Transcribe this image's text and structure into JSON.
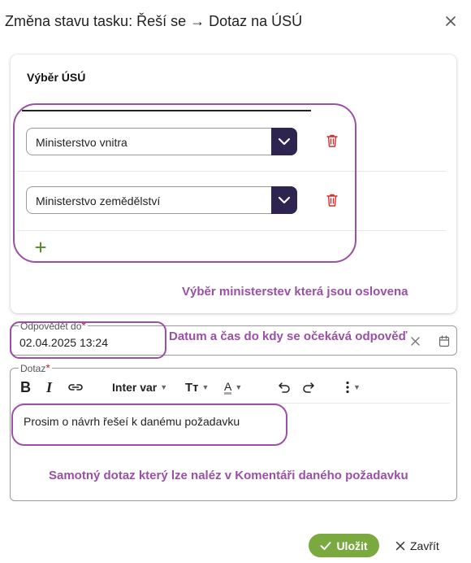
{
  "dialog": {
    "title": "Změna stavu tasku: Řeší se → Dotaz na ÚSÚ"
  },
  "selection": {
    "title": "Výběr ÚSÚ",
    "rows": [
      {
        "value": "Ministerstvo vnitra"
      },
      {
        "value": "Ministerstvo zemědělství"
      }
    ],
    "annotation": "Výběr ministerstev která jsou oslovena"
  },
  "deadline": {
    "label": "Odpovědět do",
    "required_mark": "*",
    "value": "02.04.2025 13:24",
    "annotation": "Datum a čas do kdy se očekává odpověď"
  },
  "query": {
    "label": "Dotaz",
    "required_mark": "*",
    "toolbar": {
      "bold": "B",
      "italic": "I",
      "font": "Inter var",
      "text_size": "Tт",
      "text_color": "A"
    },
    "content": "Prosim o návrh řešeí k danému požadavku",
    "annotation": "Samotný dotaz který lze naléz v Komentáři daného požadavku"
  },
  "footer": {
    "save_label": "Uložit",
    "close_label": "Zavřít"
  },
  "colors": {
    "brand_dark": "#2e2450",
    "save_green": "#79a93f",
    "annotation": "#9b4fa7",
    "delete_red": "#d32f2f",
    "add_green": "#5b8f2c"
  }
}
